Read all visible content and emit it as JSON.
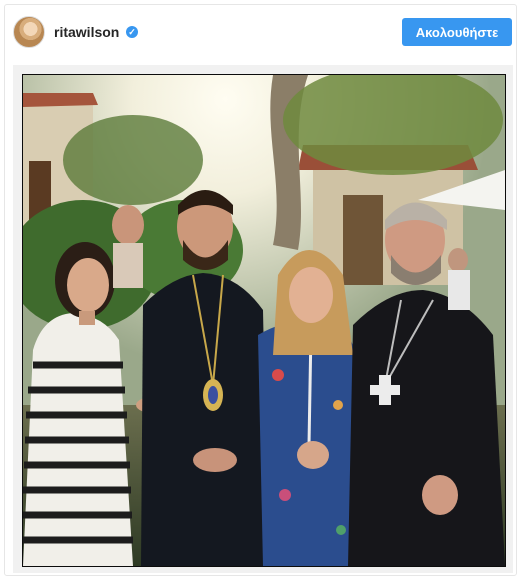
{
  "post": {
    "username": "ritawilson",
    "verified_icon": "verified-badge-icon",
    "follow_label": "Ακολουθήστε",
    "accent_color": "#3897f0"
  }
}
